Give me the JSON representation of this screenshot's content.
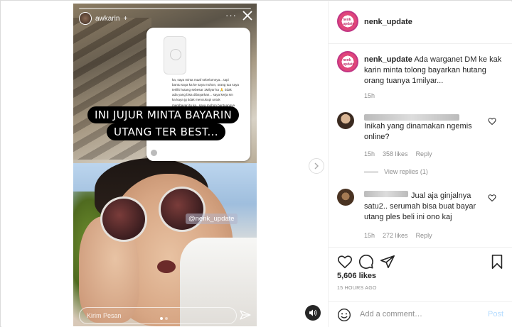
{
  "story": {
    "username": "awkarin",
    "more_icon": "more-horizontal-icon",
    "close_icon": "close-icon",
    "caption_line1": "INI JUJUR MINTA BAYARIN",
    "caption_line2": "UTANG TER BEST...",
    "dm_text": "ka, saya minta maaf sebelumnya... tapi\nbantu saya ka ke saya mohon, orang tua saya\nterlilit hutang sebesar 1Milyar ka 🙏 tidak\nada yang bisa dibayarkan... saya kerja sm\nka kaya jg tidak mencukupi untuk\nmembayar itu ka.. saya mohon bantuannya\n\nsaya gatau harus minta tolong ke siapa\nlagi...",
    "mention": "@nenk_update",
    "send_placeholder": "Kirim Pesan",
    "progress": 0.0
  },
  "post": {
    "username": "nenk_update",
    "caption_user": "nenk_update",
    "caption_text": "Ada warganet DM ke kak karin minta tolong bayarkan hutang orang tuanya 1milyar...",
    "caption_time": "15h",
    "likes": "5,606 likes",
    "ago": "15 HOURS AGO",
    "add_comment_placeholder": "Add a comment…",
    "post_label": "Post",
    "avatar_text": "nenk update"
  },
  "comments": [
    {
      "text": "Inikah yang dinamakan ngemis online?",
      "time": "15h",
      "likes": "358 likes",
      "reply": "Reply",
      "view_replies": "View replies (1)"
    },
    {
      "text": "Jual aja ginjalnya satu2.. serumah bisa buat bayar utang ples beli ini ono kaj",
      "time": "15h",
      "likes": "272 likes",
      "reply": "Reply"
    }
  ],
  "colors": {
    "brand_pink": "#c13584",
    "post_disabled": "#b3dbff",
    "muted": "#8e8e8e",
    "text": "#262626"
  }
}
